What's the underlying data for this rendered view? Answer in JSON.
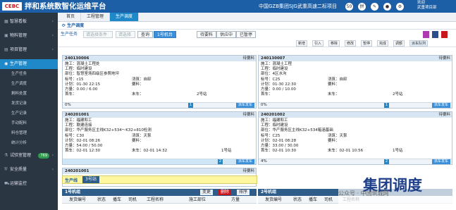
{
  "header": {
    "logo": "CEBC",
    "app_title": "拌和系统数智化运维平台",
    "project_title": "中国GZB集团SJG武重高速二标项目",
    "icons": [
      "50",
      "拼",
      "✎",
      "●",
      "⚙"
    ],
    "user_line1": "欢迎",
    "user_line2": "武重项目部"
  },
  "sidebar": {
    "items": [
      {
        "label": "智慧看板"
      },
      {
        "label": "物料管理"
      },
      {
        "label": "项目管理"
      },
      {
        "label": "生产管理"
      }
    ],
    "sub": [
      "生产任务",
      "生产调度",
      "剩料处置",
      "发货记录",
      "生产记录",
      "手动配料",
      "料仓管理",
      "统计分析"
    ],
    "bottom": [
      {
        "label": "试验室管理",
        "badge": "769"
      },
      {
        "label": "安全质量"
      },
      {
        "label": "运输监控"
      }
    ]
  },
  "tabs": [
    "首页",
    "工程管理",
    "生产调度"
  ],
  "section_title": "生产调度",
  "filters": {
    "label": "生产任务",
    "input1": "请选择条件",
    "input2": "请选择",
    "query": "查询",
    "select": "1号机台",
    "status_tabs": [
      "待要料",
      "供应中",
      "已暂停"
    ]
  },
  "actions": [
    "新增",
    "引入",
    "移除",
    "修改",
    "暂停",
    "完成",
    "调额",
    "派车队列"
  ],
  "cards": [
    {
      "id": "240130006",
      "tag": "待要料",
      "unit": "施工：混凝土工程处",
      "project": "工程：临时建设",
      "part": "部位：智慧室场四级区参照地坪",
      "grade": "标号：c15",
      "pour": "浇筑：自卸",
      "plan": "计划：01-30 22:15",
      "req": "要料：",
      "qty": "方量：0.00 / 6.00",
      "veh": "首车：",
      "last": "末车：",
      "station": "2号站",
      "page": "1",
      "dispatch": "派车发车",
      "foot": "0%"
    },
    {
      "id": "240130007",
      "tag": "待要料",
      "unit": "施工：混凝土工程",
      "project": "工程：临时建设",
      "part": "部位：4区水沟",
      "grade": "标号：C25",
      "pour": "浇筑：自卸",
      "plan": "计划：01-30 22:30",
      "req": "要料：",
      "qty": "方量：0.00 / 10.00",
      "veh": "首车：",
      "last": "末车：",
      "station": "2号站",
      "page": "1",
      "dispatch": "派车发车",
      "foot": "0%"
    },
    {
      "id": "240201001",
      "tag": "待要料",
      "unit": "施工：福建和工",
      "project": "工程：联建连接",
      "part": "部位：华产服务区主线K32+534～K32+810检测",
      "grade": "标号：C30",
      "pour": "浇筑：天泵",
      "plan": "计划：02-01 08:26",
      "req": "要料：",
      "qty": "方量：54.00 / 50.00",
      "veh": "首车：02-01 12:30",
      "last": "末车：02-01 14:32",
      "station": "1号站",
      "page": "2",
      "dispatch": "派车发车",
      "foot": ""
    },
    {
      "id": "240201002",
      "tag": "待要料",
      "unit": "施工：福建和工",
      "project": "工程：临时建设",
      "part": "部位：华产服务区主线K32+534箱涵基础",
      "grade": "标号：C25",
      "pour": "浇筑：天泵",
      "plan": "计划：02-01 08:28",
      "req": "要料：",
      "qty": "方量：33.00 / 30.00",
      "veh": "首车：02-01 10:30",
      "last": "末车：02-01 10:56",
      "station": "1号站",
      "page": "2",
      "dispatch": "派车发车",
      "foot": "4%"
    },
    {
      "id": "240201001",
      "tag": "待要料",
      "unit": "",
      "project": "",
      "part": "",
      "grade": "",
      "pour": "",
      "plan": "",
      "req": "",
      "qty": "",
      "veh": "",
      "last": "",
      "station": "",
      "page": "",
      "dispatch": "",
      "foot": ""
    }
  ],
  "strip": {
    "label": "生产线",
    "value": "3号站"
  },
  "grids": [
    {
      "title": "1号机组",
      "btns": [
        "变更",
        "删除",
        "排序"
      ]
    },
    {
      "title": "2号机组"
    }
  ],
  "columns": [
    "发货编号",
    "状态",
    "播车",
    "司机",
    "工程名称",
    "施工部位",
    "方量"
  ],
  "watermark": {
    "big": "集团调度",
    "small": "公众号 · 中国筑城网"
  }
}
